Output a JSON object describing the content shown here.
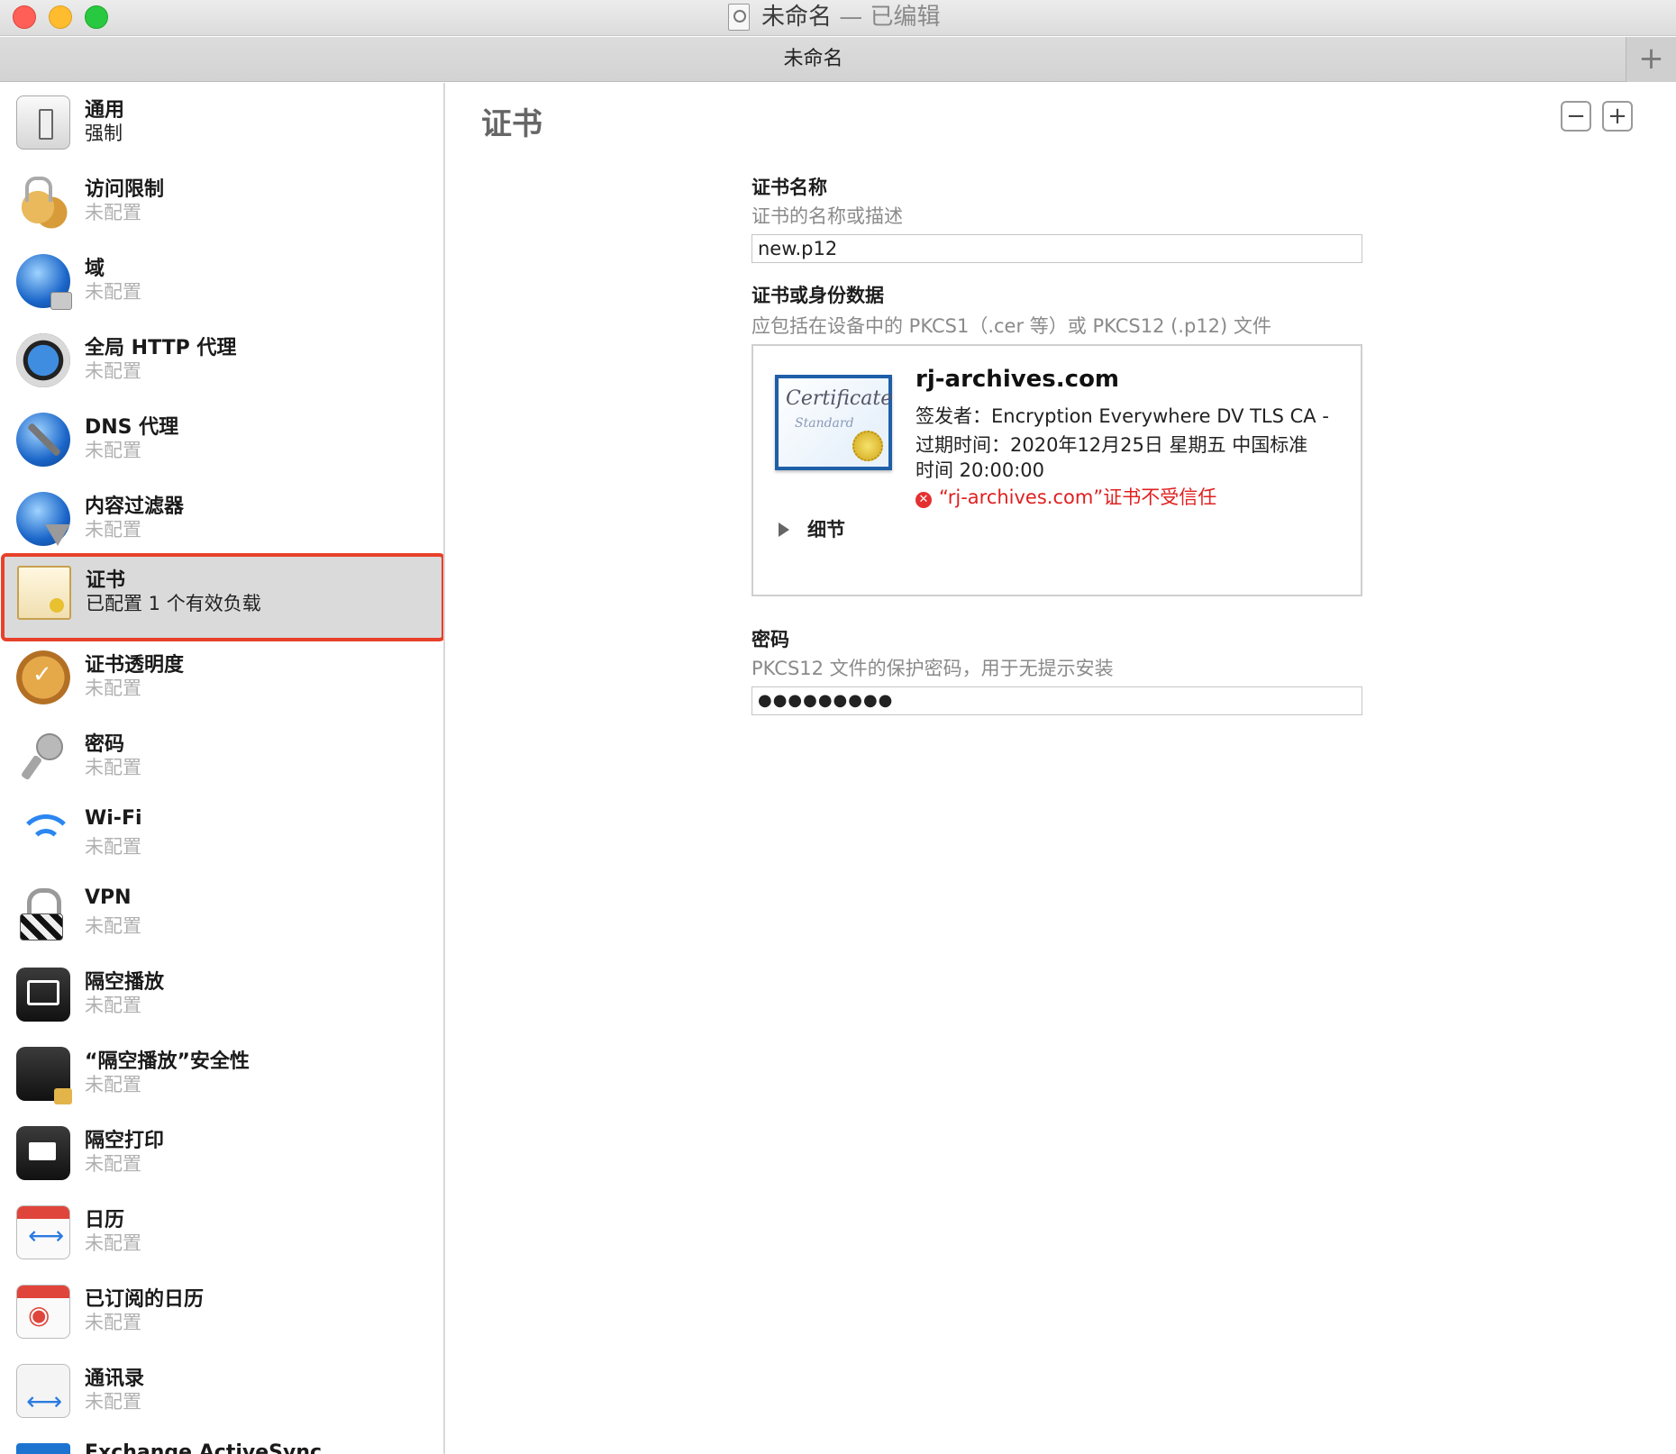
{
  "window": {
    "title": "未命名",
    "title_suffix": " — 已编辑"
  },
  "tab": {
    "title": "未命名",
    "add_label": "+"
  },
  "sidebar": {
    "items": [
      {
        "label": "通用",
        "sub": "强制",
        "icon": "toggle-switch-icon"
      },
      {
        "label": "访问限制",
        "sub": "未配置",
        "icon": "padlocks-icon"
      },
      {
        "label": "域",
        "sub": "未配置",
        "icon": "globe-lock-icon"
      },
      {
        "label": "全局 HTTP 代理",
        "sub": "未配置",
        "icon": "globe-proxy-icon"
      },
      {
        "label": "DNS 代理",
        "sub": "未配置",
        "icon": "globe-tools-icon"
      },
      {
        "label": "内容过滤器",
        "sub": "未配置",
        "icon": "globe-filter-icon"
      },
      {
        "label": "证书",
        "sub": "已配置 1 个有效负载",
        "icon": "certificate-icon",
        "selected": true
      },
      {
        "label": "证书透明度",
        "sub": "未配置",
        "icon": "verified-badge-icon"
      },
      {
        "label": "密码",
        "sub": "未配置",
        "icon": "key-icon"
      },
      {
        "label": "Wi-Fi",
        "sub": "未配置",
        "icon": "wifi-icon"
      },
      {
        "label": "VPN",
        "sub": "未配置",
        "icon": "vpn-lock-icon"
      },
      {
        "label": "隔空播放",
        "sub": "未配置",
        "icon": "airplay-icon"
      },
      {
        "label": "“隔空播放”安全性",
        "sub": "未配置",
        "icon": "airplay-security-icon"
      },
      {
        "label": "隔空打印",
        "sub": "未配置",
        "icon": "airprint-icon"
      },
      {
        "label": "日历",
        "sub": "未配置",
        "icon": "calendar-sync-icon"
      },
      {
        "label": "已订阅的日历",
        "sub": "未配置",
        "icon": "subscribed-calendar-icon"
      },
      {
        "label": "通讯录",
        "sub": "未配置",
        "icon": "contacts-icon"
      },
      {
        "label": "Exchange ActiveSync",
        "sub": "",
        "icon": "exchange-icon"
      }
    ]
  },
  "main": {
    "title": "证书",
    "minus_label": "−",
    "plus_label": "+",
    "cert_name": {
      "label": "证书名称",
      "description": "证书的名称或描述",
      "value": "new.p12"
    },
    "cert_data": {
      "label": "证书或身份数据",
      "description": "应包括在设备中的 PKCS1（.cer 等）或 PKCS12 (.p12) 文件",
      "image_text": "Certificate",
      "image_subtext": "Standard",
      "common_name": "rj-archives.com",
      "issuer": "签发者：Encryption Everywhere DV TLS CA -",
      "expires_line1": "过期时间：2020年12月25日 星期五 中国标准",
      "expires_line2": "时间 20:00:00",
      "warning": "“rj-archives.com”证书不受信任",
      "details_label": "细节"
    },
    "password": {
      "label": "密码",
      "description": "PKCS12 文件的保护密码，用于无提示安装",
      "value": "●●●●●●●●●"
    }
  }
}
